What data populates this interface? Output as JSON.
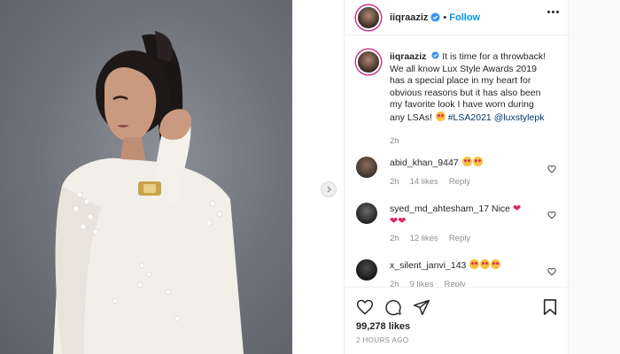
{
  "post": {
    "username": "iiqraaziz",
    "follow_label": "Follow",
    "separator": "•",
    "caption": {
      "username": "iiqraaziz",
      "text_lines": [
        "It is time for a throwback!",
        "We all know Lux Style Awards 2019",
        "has a special place in my heart for",
        "obvious reasons but it has also been",
        "my favorite look I have worn during",
        "any LSAs!"
      ],
      "hashtag": "#LSA2021",
      "mention": "@luxstylepk",
      "time": "2h"
    },
    "comments": [
      {
        "username": "abid_khan_9447",
        "text": "",
        "emoji_count": 2,
        "time": "2h",
        "likes": "14 likes",
        "reply": "Reply"
      },
      {
        "username": "syed_md_ahtesham_17",
        "text": "Nice",
        "heart_count": 3,
        "time": "2h",
        "likes": "12 likes",
        "reply": "Reply"
      },
      {
        "username": "x_silent_janvi_143",
        "text": "",
        "emoji_count": 3,
        "time": "2h",
        "likes": "9 likes",
        "reply": "Reply"
      }
    ],
    "likes_count": "99,278 likes",
    "post_date": "2 HOURS AGO"
  },
  "colors": {
    "follow_blue": "#0095f6",
    "link_blue": "#00376b",
    "muted": "#8e8e8e",
    "heart_red": "#e0245e"
  },
  "icons": [
    "verified-badge-icon",
    "more-options-icon",
    "heart-icon",
    "comment-icon",
    "share-icon",
    "bookmark-icon",
    "chevron-right-icon"
  ]
}
